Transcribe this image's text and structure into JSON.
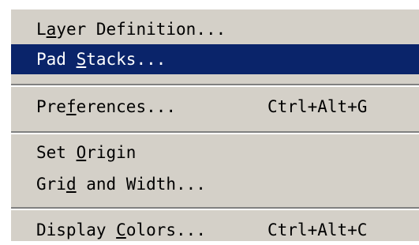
{
  "menu": {
    "items": [
      {
        "pre": "L",
        "mn": "a",
        "post": "yer Definition...",
        "shortcut": "",
        "selected": false
      },
      {
        "pre": "Pad ",
        "mn": "S",
        "post": "tacks...",
        "shortcut": "",
        "selected": true
      },
      {
        "pre": "Pre",
        "mn": "f",
        "post": "erences...",
        "shortcut": "Ctrl+Alt+G",
        "selected": false
      },
      {
        "pre": "Set ",
        "mn": "O",
        "post": "rigin",
        "shortcut": "",
        "selected": false
      },
      {
        "pre": "Gri",
        "mn": "d",
        "post": " and Width...",
        "shortcut": "",
        "selected": false
      },
      {
        "pre": "Display ",
        "mn": "C",
        "post": "olors...",
        "shortcut": "Ctrl+Alt+C",
        "selected": false
      }
    ]
  },
  "colors": {
    "menu_bg": "#d4d0c8",
    "highlight": "#0a246a",
    "highlight_text": "#ffffff"
  }
}
